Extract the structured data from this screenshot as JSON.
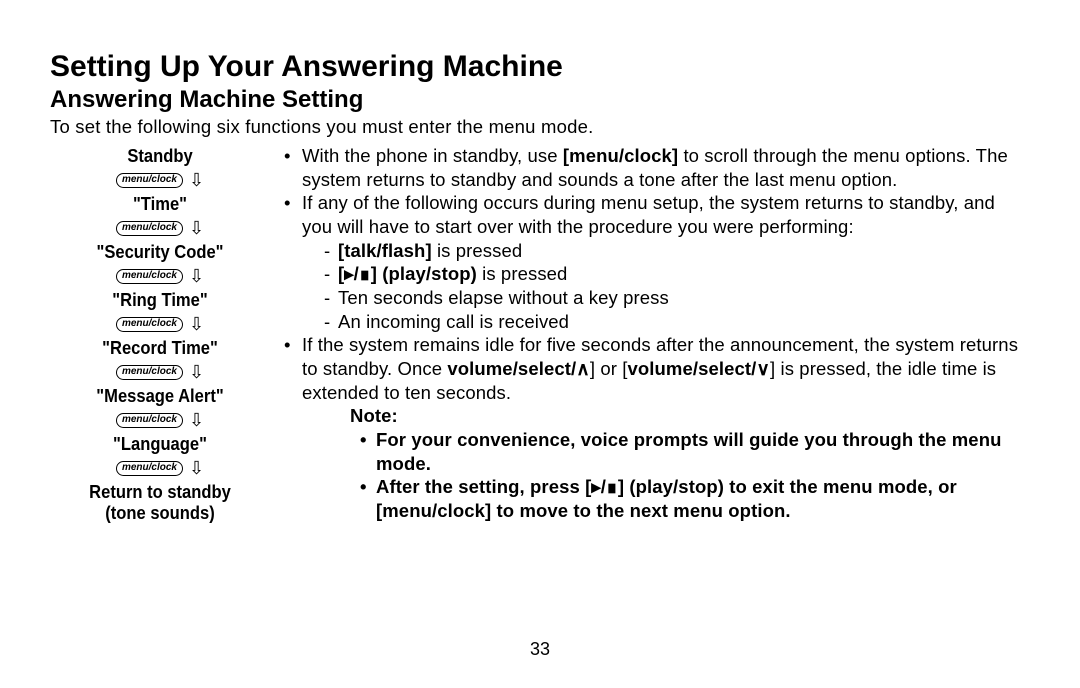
{
  "title": "Setting Up Your Answering Machine",
  "subtitle": "Answering Machine Setting",
  "intro": "To set the following six functions you must enter the menu mode.",
  "flow": {
    "btn": "menu/clock",
    "items": [
      "Standby",
      "\"Time\"",
      "\"Security Code\"",
      "\"Ring Time\"",
      "\"Record Time\"",
      "\"Message Alert\"",
      "\"Language\""
    ],
    "return1": "Return to standby",
    "return2": "(tone sounds)"
  },
  "body": {
    "b1a": "With the phone in standby, use ",
    "b1b": "[menu/clock]",
    "b1c": " to scroll through the menu options. The system returns to standby and sounds a tone after the last menu option.",
    "b2": "If any of the following occurs during menu setup, the system returns to standby, and you will have to start over with the procedure you were performing:",
    "d1a": "[talk/flash]",
    "d1b": " is pressed",
    "d2a": "[▸/∎] (play/stop)",
    "d2b": " is pressed",
    "d3": "Ten seconds elapse without a key press",
    "d4": "An incoming call is received",
    "b3a": "If the system remains idle for five seconds after the announcement, the system returns to standby. Once ",
    "b3b": "volume/select/∧",
    "b3c": "] or [",
    "b3d": "volume/select/∨",
    "b3e": "] is pressed, the idle time is extended to ten seconds.",
    "noteLabel": "Note:",
    "n1": "For your convenience, voice prompts will guide you through the menu mode.",
    "n2": "After the setting, press [▸/∎] (play/stop) to exit the menu mode, or [menu/clock] to move to the next menu option."
  },
  "pageNum": "33"
}
